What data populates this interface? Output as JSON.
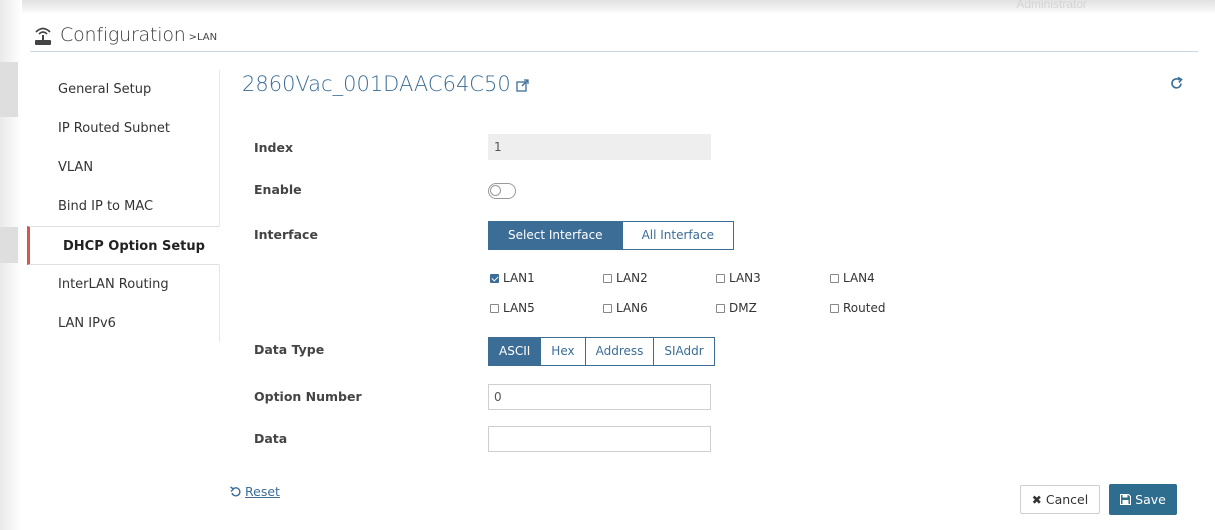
{
  "header": {
    "title": "Configuration",
    "breadcrumb": ">LAN",
    "ghost_user": "Administrator"
  },
  "sidebar": {
    "items": [
      {
        "label": "General Setup"
      },
      {
        "label": "IP Routed Subnet"
      },
      {
        "label": "VLAN"
      },
      {
        "label": "Bind IP to MAC"
      },
      {
        "label": "DHCP Option Setup",
        "active": true
      },
      {
        "label": "InterLAN Routing"
      },
      {
        "label": "LAN IPv6"
      }
    ]
  },
  "main": {
    "device_name": "2860Vac_001DAAC64C50",
    "fields": {
      "index_label": "Index",
      "index_value": "1",
      "enable_label": "Enable",
      "enable_on": false,
      "interface_label": "Interface",
      "interface_options": [
        "Select Interface",
        "All Interface"
      ],
      "interface_selected": "Select Interface",
      "lan_checkboxes": [
        {
          "label": "LAN1",
          "checked": true
        },
        {
          "label": "LAN2",
          "checked": false
        },
        {
          "label": "LAN3",
          "checked": false
        },
        {
          "label": "LAN4",
          "checked": false
        },
        {
          "label": "LAN5",
          "checked": false
        },
        {
          "label": "LAN6",
          "checked": false
        },
        {
          "label": "DMZ",
          "checked": false
        },
        {
          "label": "Routed",
          "checked": false
        }
      ],
      "data_type_label": "Data Type",
      "data_type_options": [
        "ASCII",
        "Hex",
        "Address",
        "SIAddr"
      ],
      "data_type_selected": "ASCII",
      "option_number_label": "Option Number",
      "option_number_value": "0",
      "data_label": "Data",
      "data_value": ""
    }
  },
  "footer": {
    "reset_label": "Reset",
    "cancel_label": "Cancel",
    "save_label": "Save"
  },
  "colors": {
    "accent": "#3b6d97",
    "save_button": "#2f6d8f",
    "active_marker": "#d9534f"
  }
}
